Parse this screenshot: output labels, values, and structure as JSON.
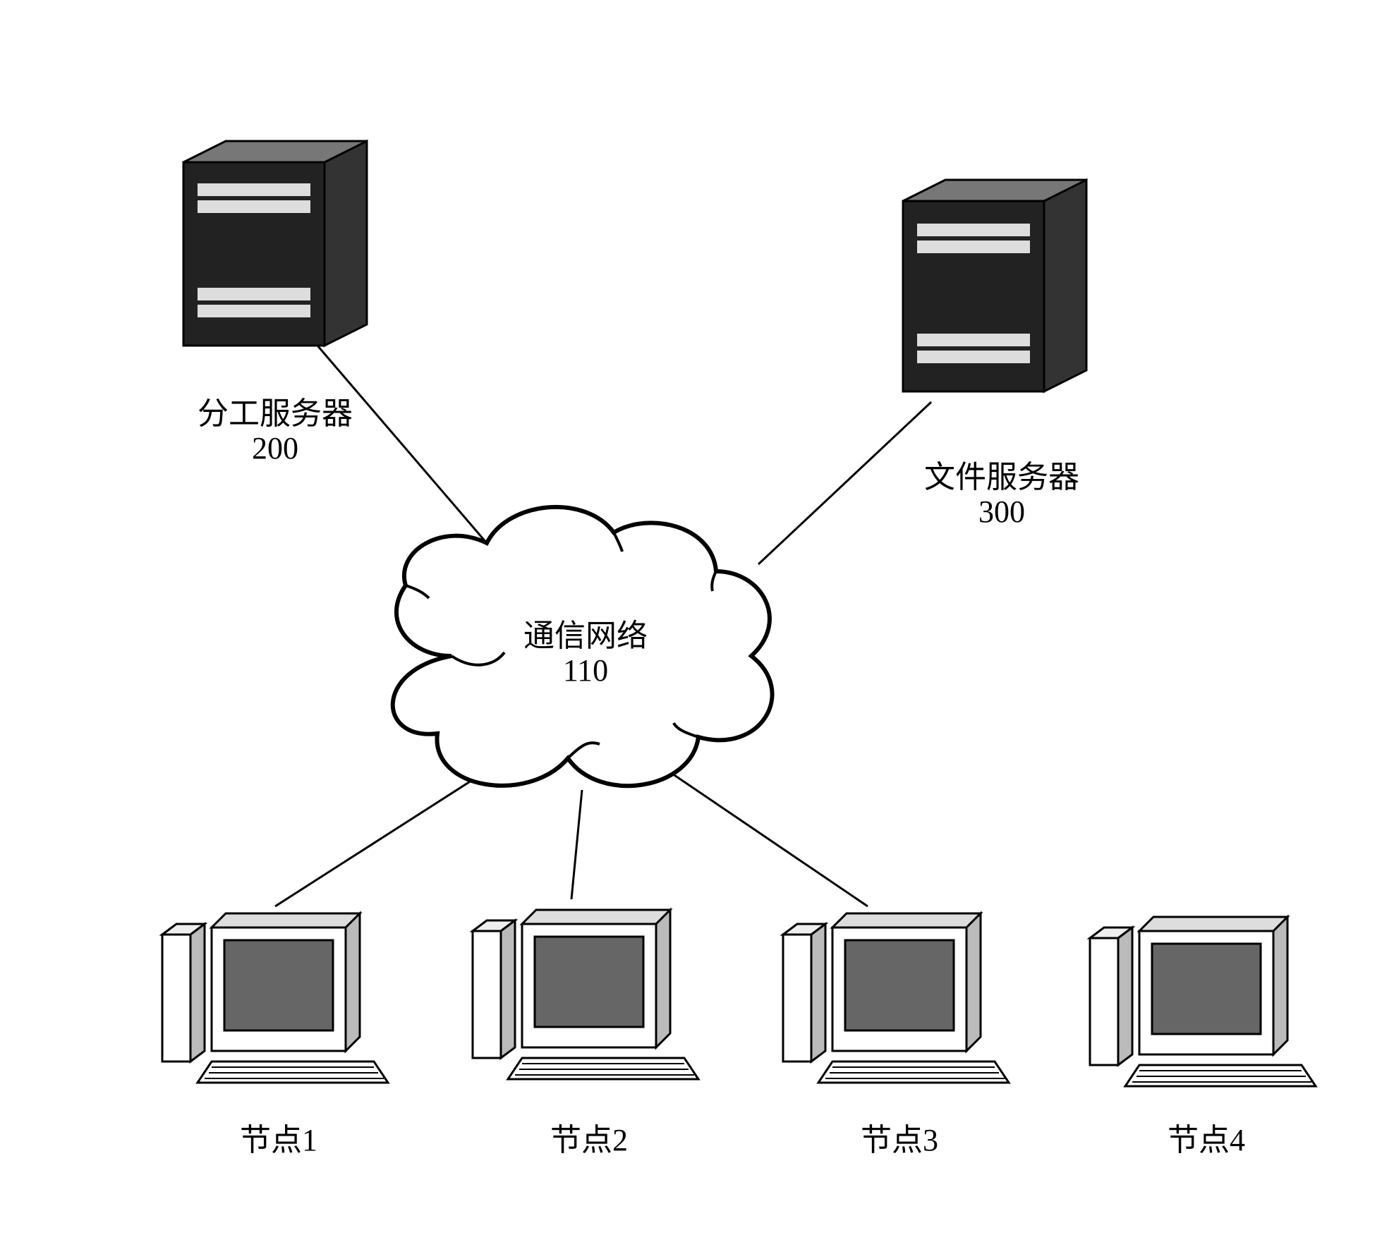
{
  "servers": {
    "left": {
      "label": "分工服务器",
      "number": "200"
    },
    "right": {
      "label": "文件服务器",
      "number": "300"
    }
  },
  "network": {
    "label": "通信网络",
    "number": "110"
  },
  "nodes": {
    "n1": "节点1",
    "n2": "节点2",
    "n3": "节点3",
    "n4": "节点4"
  }
}
